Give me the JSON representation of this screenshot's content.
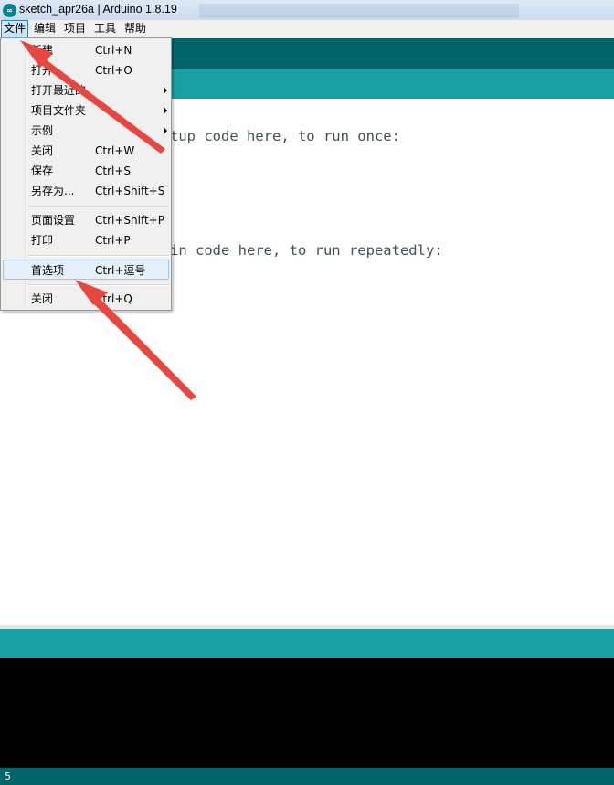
{
  "window": {
    "title": "sketch_apr26a | Arduino 1.8.19"
  },
  "menubar": {
    "items": [
      {
        "label": "文件"
      },
      {
        "label": "编辑"
      },
      {
        "label": "项目"
      },
      {
        "label": "工具"
      },
      {
        "label": "帮助"
      }
    ]
  },
  "file_menu": {
    "items": [
      {
        "label": "新建",
        "shortcut": "Ctrl+N"
      },
      {
        "label": "打开...",
        "shortcut": "Ctrl+O"
      },
      {
        "label": "打开最近的",
        "shortcut": ""
      },
      {
        "label": "项目文件夹",
        "shortcut": ""
      },
      {
        "label": "示例",
        "shortcut": ""
      },
      {
        "label": "关闭",
        "shortcut": "Ctrl+W"
      },
      {
        "label": "保存",
        "shortcut": "Ctrl+S"
      },
      {
        "label": "另存为...",
        "shortcut": "Ctrl+Shift+S"
      },
      {
        "label": "页面设置",
        "shortcut": "Ctrl+Shift+P"
      },
      {
        "label": "打印",
        "shortcut": "Ctrl+P"
      },
      {
        "label": "首选项",
        "shortcut": "Ctrl+逗号"
      },
      {
        "label": "关闭",
        "shortcut": "Ctrl+Q"
      }
    ]
  },
  "editor": {
    "line1_visible": "tup code here, to run once:",
    "line2_visible": "in code here, to run repeatedly:"
  },
  "status": {
    "line_number": "5"
  },
  "colors": {
    "toolbar": "#006468",
    "tabbar": "#17a1a5",
    "console": "#000000",
    "annotation": "#e8463e"
  }
}
